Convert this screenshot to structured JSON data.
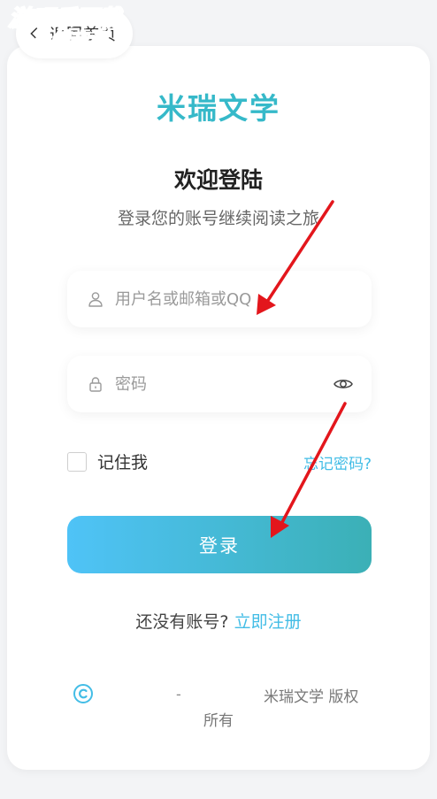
{
  "nav": {
    "back_label": "返回首页"
  },
  "watermark": {
    "line1": "游吧乐下载",
    "line2": "小编亲测"
  },
  "brand": {
    "name": "米瑞文学"
  },
  "header": {
    "title": "欢迎登陆",
    "subtitle": "登录您的账号继续阅读之旅"
  },
  "form": {
    "username_placeholder": "用户名或邮箱或QQ",
    "password_placeholder": "密码",
    "remember_label": "记住我",
    "forgot_label": "忘记密码?",
    "submit_label": "登录"
  },
  "register": {
    "prompt": "还没有账号?",
    "link": "立即注册"
  },
  "footer": {
    "separator": "-",
    "owner": "米瑞文学 版权",
    "rights": "所有"
  },
  "colors": {
    "accent": "#36b9c9",
    "link": "#43bde6",
    "arrow": "#e3161c"
  },
  "icons": [
    "chevron-left-icon",
    "user-icon",
    "lock-icon",
    "eye-icon",
    "copyright-icon"
  ]
}
